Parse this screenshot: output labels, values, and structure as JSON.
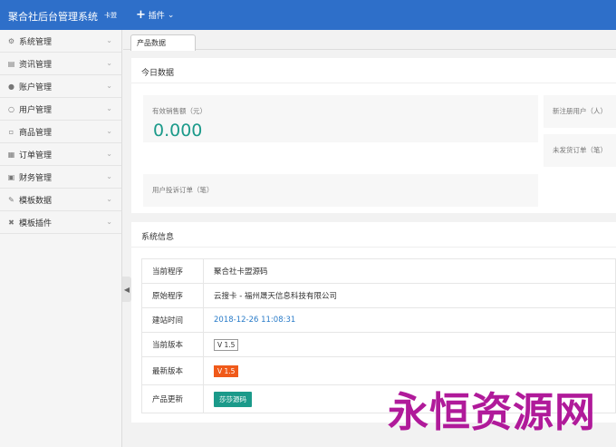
{
  "header": {
    "brand": "聚合社后台管理系统",
    "brand_tag": "卡盟",
    "plugin_menu": "插件"
  },
  "sidebar": {
    "items": [
      {
        "label": "系统管理",
        "icon": "gear-icon"
      },
      {
        "label": "资讯管理",
        "icon": "news-icon"
      },
      {
        "label": "账户管理",
        "icon": "user-icon"
      },
      {
        "label": "用户管理",
        "icon": "users-icon"
      },
      {
        "label": "商品管理",
        "icon": "cart-icon"
      },
      {
        "label": "订单管理",
        "icon": "order-icon"
      },
      {
        "label": "财务管理",
        "icon": "finance-icon"
      },
      {
        "label": "模板数据",
        "icon": "edit-icon"
      },
      {
        "label": "模板插件",
        "icon": "plugin-icon"
      }
    ]
  },
  "tabs": [
    {
      "label": "产品数据"
    }
  ],
  "today": {
    "title": "今日数据",
    "sales_label": "有效销售额（元）",
    "sales_value": "0.000",
    "new_users_label": "新注册用户（人）",
    "unshipped_label": "未发货订单（笔）",
    "complaints_label": "用户投诉订单（笔）"
  },
  "system": {
    "title": "系统信息",
    "rows": [
      {
        "key": "当前程序",
        "value": "聚合社卡盟源码"
      },
      {
        "key": "原始程序",
        "value": "云搜卡 - 福州晟天信息科技有限公司"
      },
      {
        "key": "建站时间",
        "value": "2018-12-26 11:08:31"
      },
      {
        "key": "当前版本",
        "value": "V 1.5"
      },
      {
        "key": "最新版本",
        "value": "V 1.5"
      },
      {
        "key": "产品更新",
        "value": "莎莎源码"
      }
    ]
  },
  "watermark": "永恒资源网",
  "colors": {
    "header_bg": "#2e6fc9",
    "accent_teal": "#1b9a8a",
    "badge_orange": "#f05a1a"
  }
}
